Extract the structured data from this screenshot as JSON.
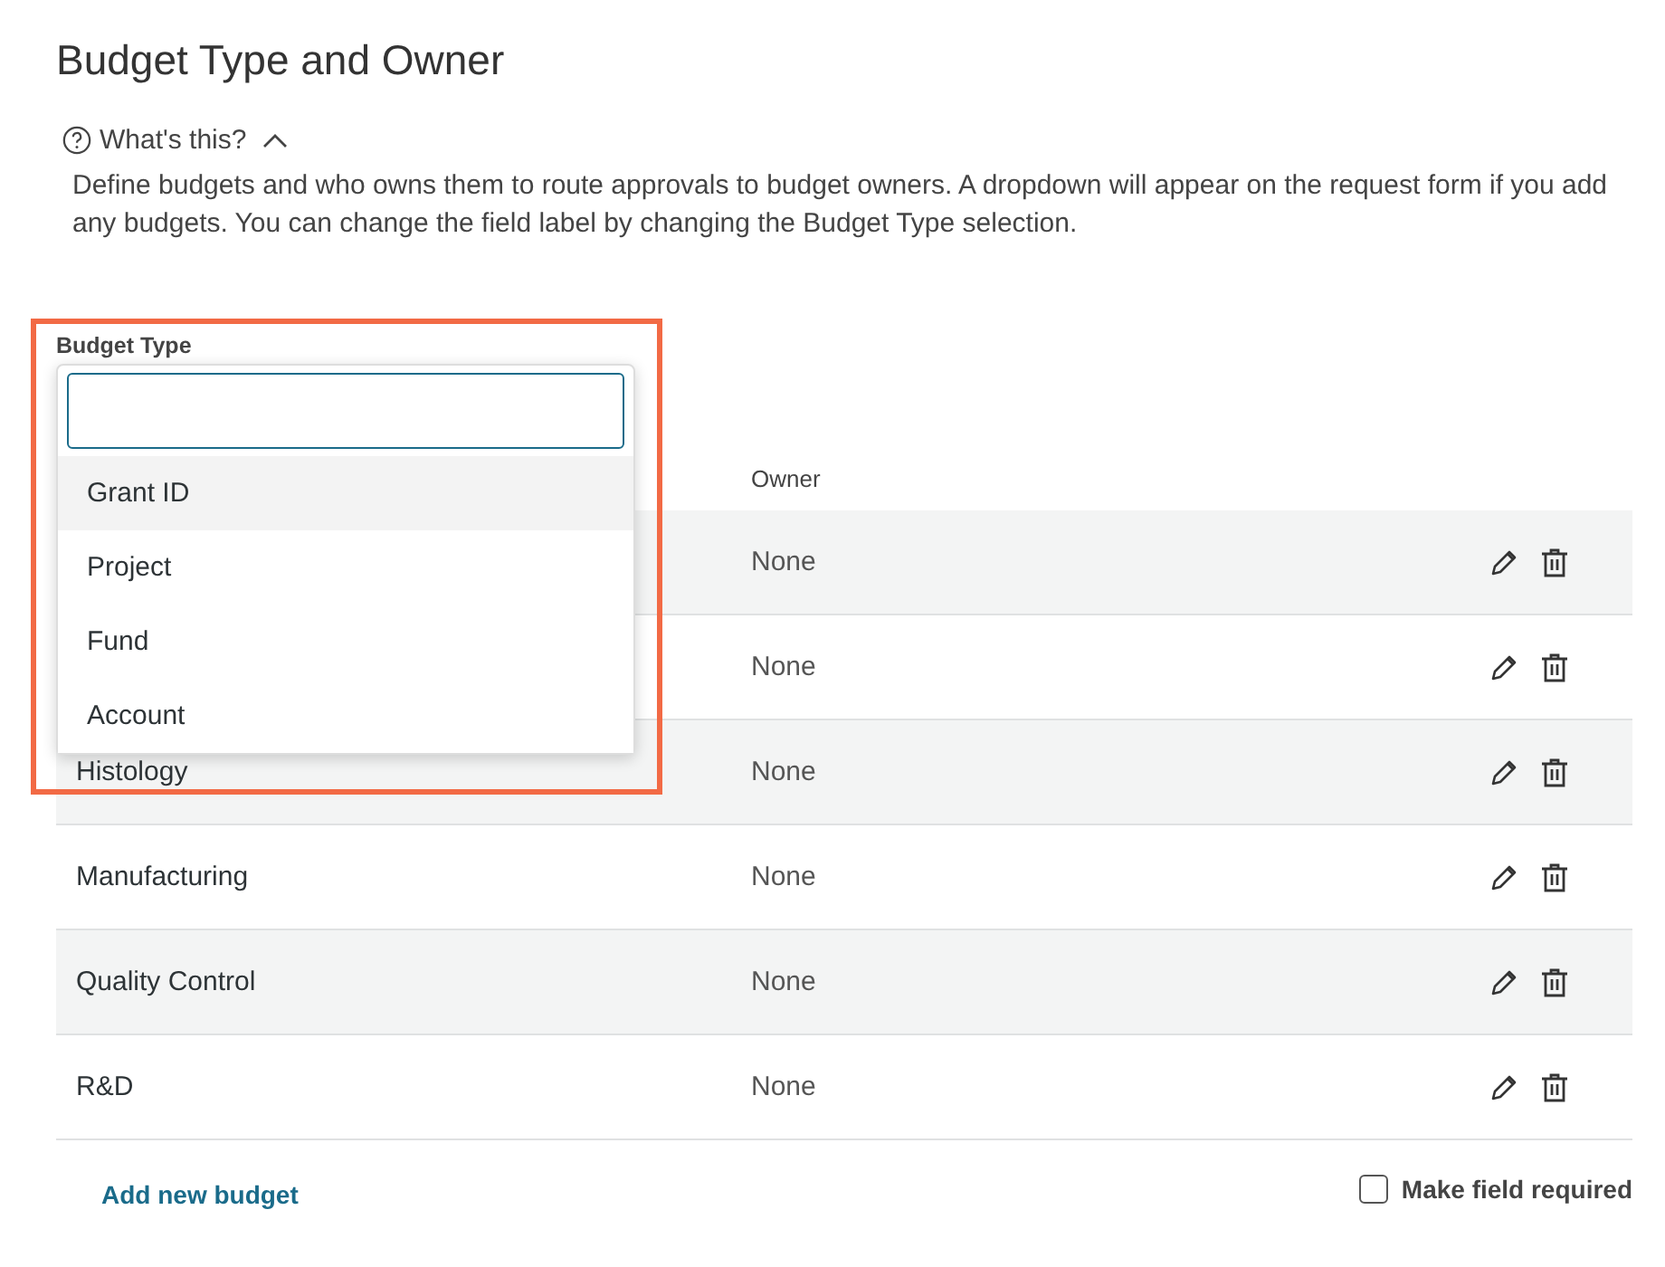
{
  "title": "Budget Type and Owner",
  "help": {
    "label": "What's this?",
    "expanded": true
  },
  "description": "Define budgets and who owns them to route approvals to budget owners. A dropdown will appear on the request form if you add any budgets. You can change the field label by changing the Budget Type selection.",
  "budget_type": {
    "label": "Budget Type",
    "dropdown": {
      "options": [
        {
          "label": "Grant ID",
          "selected": true
        },
        {
          "label": "Project",
          "selected": false
        },
        {
          "label": "Fund",
          "selected": false
        },
        {
          "label": "Account",
          "selected": false
        }
      ]
    }
  },
  "table": {
    "columns": [
      "Owner"
    ],
    "rows": [
      {
        "owner": "None"
      },
      {
        "owner": "None"
      },
      {
        "name": "Histology",
        "owner": "None"
      },
      {
        "name": "Manufacturing",
        "owner": "None"
      },
      {
        "name": "Quality Control",
        "owner": "None"
      },
      {
        "name": "R&D",
        "owner": "None"
      }
    ]
  },
  "add_link": "Add new budget",
  "required": {
    "label": "Make field required",
    "checked": false
  }
}
